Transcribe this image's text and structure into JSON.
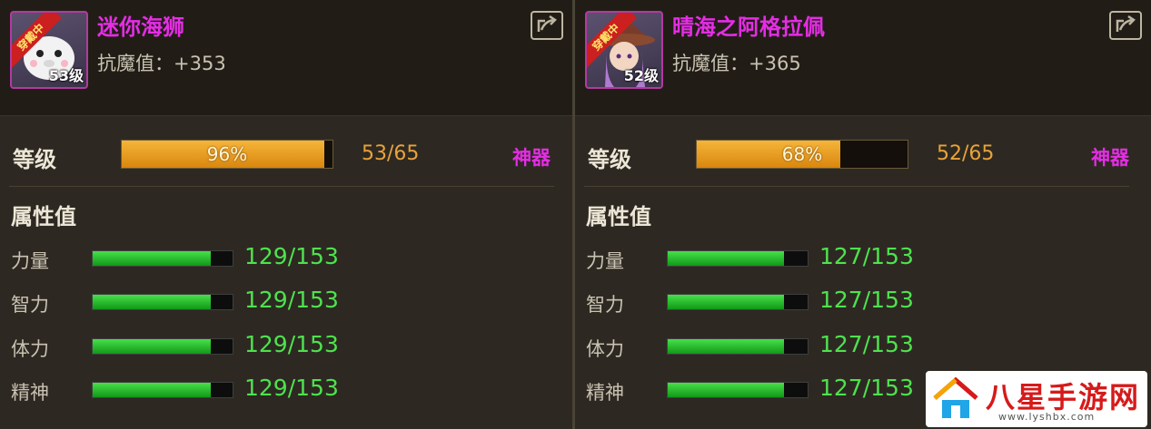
{
  "colors": {
    "name": "#e52de5",
    "artifact": "#e52de5",
    "level_fill": "#f5b53a",
    "attr_fill": "#47e04a",
    "attr_value": "#4ee24e",
    "level_value": "#e9a23a",
    "badge": "#cc1f1f"
  },
  "icons": {
    "share": "share-icon"
  },
  "left": {
    "badge": "穿戴中",
    "level_badge": "53级",
    "name": "迷你海狮",
    "resist": "抗魔值：+353",
    "level_label": "等级",
    "level_progress": 0.96,
    "level_percent": "96%",
    "level_value": "53/65",
    "artifact": "神器",
    "attr_title": "属性值",
    "attrs": [
      {
        "label": "力量",
        "value": "129/153",
        "progress": 0.843
      },
      {
        "label": "智力",
        "value": "129/153",
        "progress": 0.843
      },
      {
        "label": "体力",
        "value": "129/153",
        "progress": 0.843
      },
      {
        "label": "精神",
        "value": "129/153",
        "progress": 0.843
      }
    ]
  },
  "right": {
    "badge": "穿戴中",
    "level_badge": "52级",
    "name": "晴海之阿格拉佩",
    "resist": "抗魔值：+365",
    "level_label": "等级",
    "level_progress": 0.68,
    "level_percent": "68%",
    "level_value": "52/65",
    "artifact": "神器",
    "attr_title": "属性值",
    "attrs": [
      {
        "label": "力量",
        "value": "127/153",
        "progress": 0.83
      },
      {
        "label": "智力",
        "value": "127/153",
        "progress": 0.83
      },
      {
        "label": "体力",
        "value": "127/153",
        "progress": 0.83
      },
      {
        "label": "精神",
        "value": "127/153",
        "progress": 0.83
      }
    ]
  },
  "watermark": {
    "text": "八星手游网",
    "url": "www.lyshbx.com"
  }
}
